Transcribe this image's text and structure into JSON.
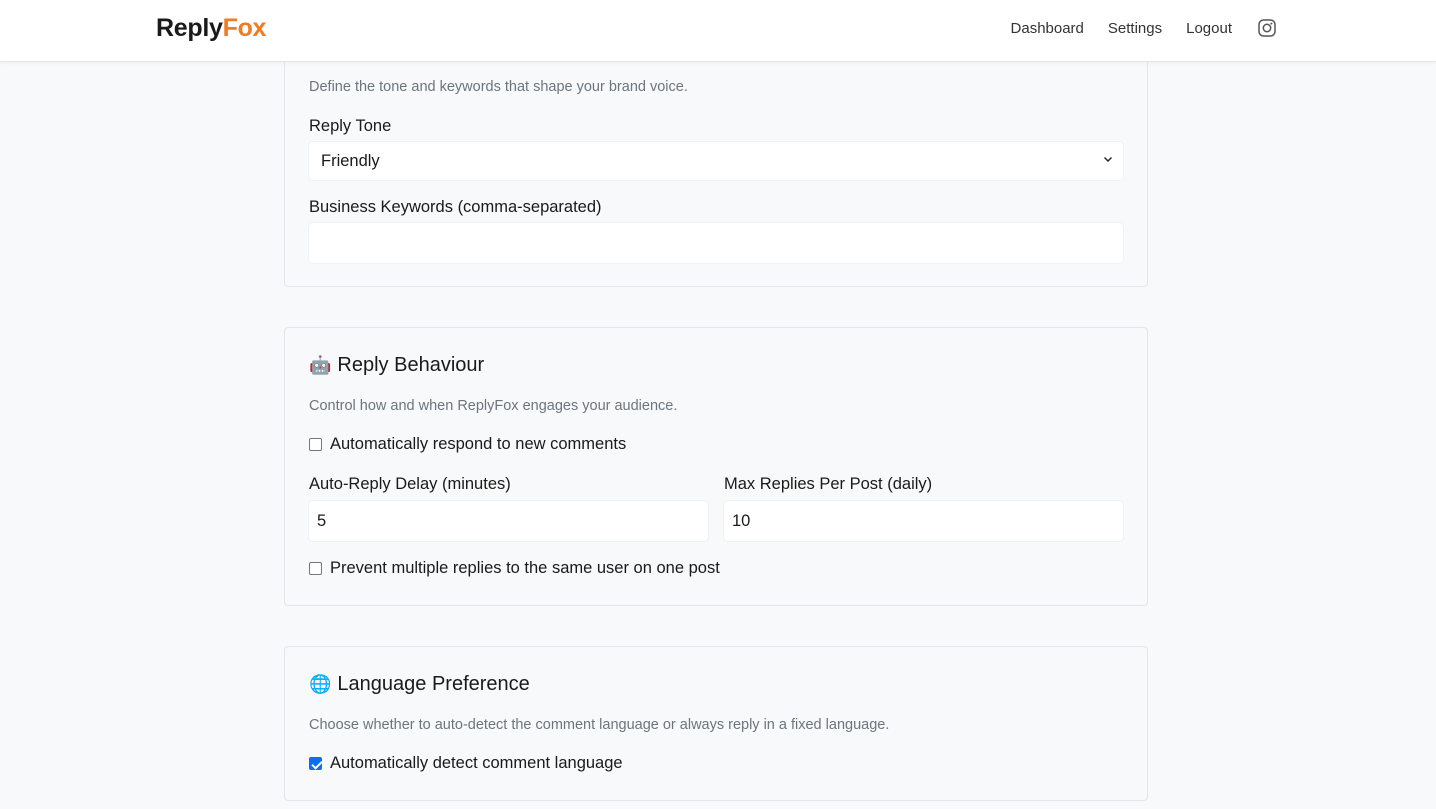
{
  "nav": {
    "brand_part1": "Reply",
    "brand_part2": "Fox",
    "links": [
      "Dashboard",
      "Settings",
      "Logout"
    ],
    "icon": "instagram-icon",
    "brand_accent_color": "#f47a1f"
  },
  "brand_card": {
    "description": "Define the tone and keywords that shape your brand voice.",
    "tone_label": "Reply Tone",
    "tone_value": "Friendly",
    "keywords_label": "Business Keywords (comma-separated)",
    "keywords_value": ""
  },
  "behaviour_card": {
    "emoji": "🤖",
    "title": "Reply Behaviour",
    "description": "Control how and when ReplyFox engages your audience.",
    "auto_respond_label": "Automatically respond to new comments",
    "auto_respond_checked": false,
    "delay_label": "Auto-Reply Delay (minutes)",
    "delay_value": "5",
    "max_replies_label": "Max Replies Per Post (daily)",
    "max_replies_value": "10",
    "prevent_multiple_label": "Prevent multiple replies to the same user on one post",
    "prevent_multiple_checked": false
  },
  "language_card": {
    "emoji": "🌐",
    "title": "Language Preference",
    "description": "Choose whether to auto-detect the comment language or always reply in a fixed language.",
    "auto_detect_label": "Automatically detect comment language",
    "auto_detect_checked": true
  }
}
